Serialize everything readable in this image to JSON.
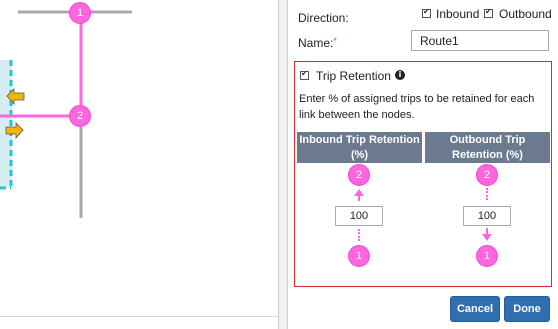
{
  "map": {
    "nodes": [
      {
        "label": "1"
      },
      {
        "label": "2"
      }
    ]
  },
  "panel": {
    "direction_label": "Direction:",
    "inbound_label": "Inbound",
    "outbound_label": "Outbound",
    "inbound_checked": true,
    "outbound_checked": true,
    "name_label": "Name:",
    "required_mark": "*",
    "name_value": "Route1",
    "trip_retention": {
      "checked": true,
      "label": "Trip Retention",
      "info_icon": "info-circle-icon",
      "description": "Enter % of assigned trips to be retained for each link between the nodes.",
      "inbound_header": "Inbound Trip Retention (%)",
      "outbound_header": "Outbound Trip Retention (%)",
      "inbound": {
        "top_node": "2",
        "bottom_node": "1",
        "value": "100"
      },
      "outbound": {
        "top_node": "2",
        "bottom_node": "1",
        "value": "100"
      }
    },
    "cancel_label": "Cancel",
    "done_label": "Done"
  },
  "colors": {
    "node_pink": "#ff66dd",
    "route_line": "#ff66dd",
    "header_slate": "#6b7a8f",
    "button_blue": "#2f6fad",
    "retention_border": "#d62d2d",
    "zone_dashed": "#22c4d6",
    "arrow_yellow": "#f2b705"
  }
}
